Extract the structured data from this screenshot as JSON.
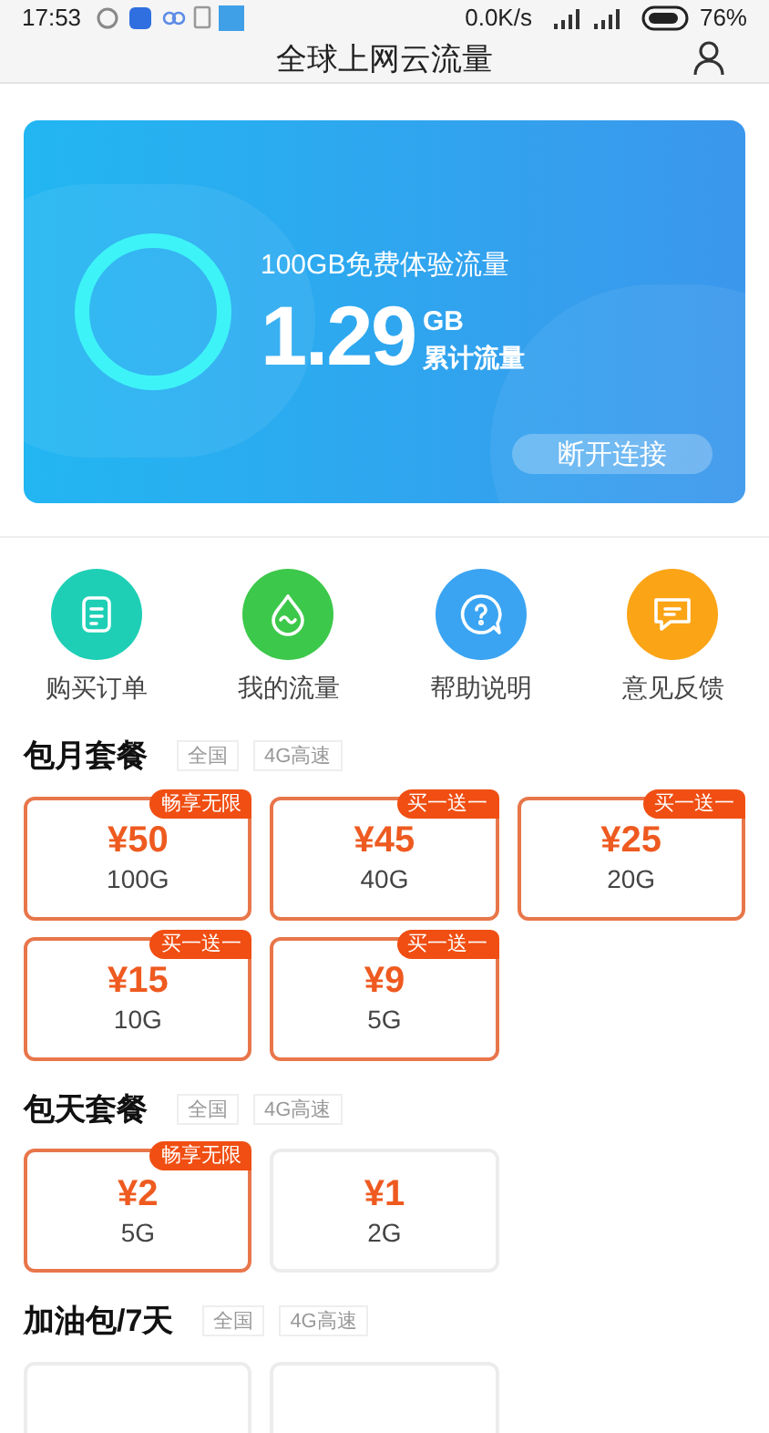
{
  "status_bar": {
    "time": "17:53",
    "speed": "0.0K/s",
    "battery": "76%"
  },
  "header": {
    "title": "全球上网云流量"
  },
  "banner": {
    "subtitle": "100GB免费体验流量",
    "amount": "1.29",
    "unit": "GB",
    "caption": "累计流量",
    "button": "断开连接"
  },
  "shortcuts": [
    {
      "label": "购买订单",
      "color": "#1ecfb5",
      "kind": "order"
    },
    {
      "label": "我的流量",
      "color": "#3cc84a",
      "kind": "drop"
    },
    {
      "label": "帮助说明",
      "color": "#3aa4f2",
      "kind": "help"
    },
    {
      "label": "意见反馈",
      "color": "#fba416",
      "kind": "feedback"
    }
  ],
  "sections": [
    {
      "title": "包月套餐",
      "tags": [
        "全国",
        "4G高速"
      ],
      "plans": [
        {
          "price": "¥50",
          "size": "100G",
          "badge": "畅享无限",
          "highlighted": true
        },
        {
          "price": "¥45",
          "size": "40G",
          "badge": "买一送一",
          "highlighted": true
        },
        {
          "price": "¥25",
          "size": "20G",
          "badge": "买一送一",
          "highlighted": true
        },
        {
          "price": "¥15",
          "size": "10G",
          "badge": "买一送一",
          "highlighted": true
        },
        {
          "price": "¥9",
          "size": "5G",
          "badge": "买一送一",
          "highlighted": true
        }
      ]
    },
    {
      "title": "包天套餐",
      "tags": [
        "全国",
        "4G高速"
      ],
      "plans": [
        {
          "price": "¥2",
          "size": "5G",
          "badge": "畅享无限",
          "highlighted": true
        },
        {
          "price": "¥1",
          "size": "2G",
          "highlighted": false
        }
      ]
    },
    {
      "title": "加油包/7天",
      "tags": [
        "全国",
        "4G高速"
      ],
      "plans": [
        {
          "highlighted": false
        },
        {
          "highlighted": false
        }
      ]
    }
  ]
}
